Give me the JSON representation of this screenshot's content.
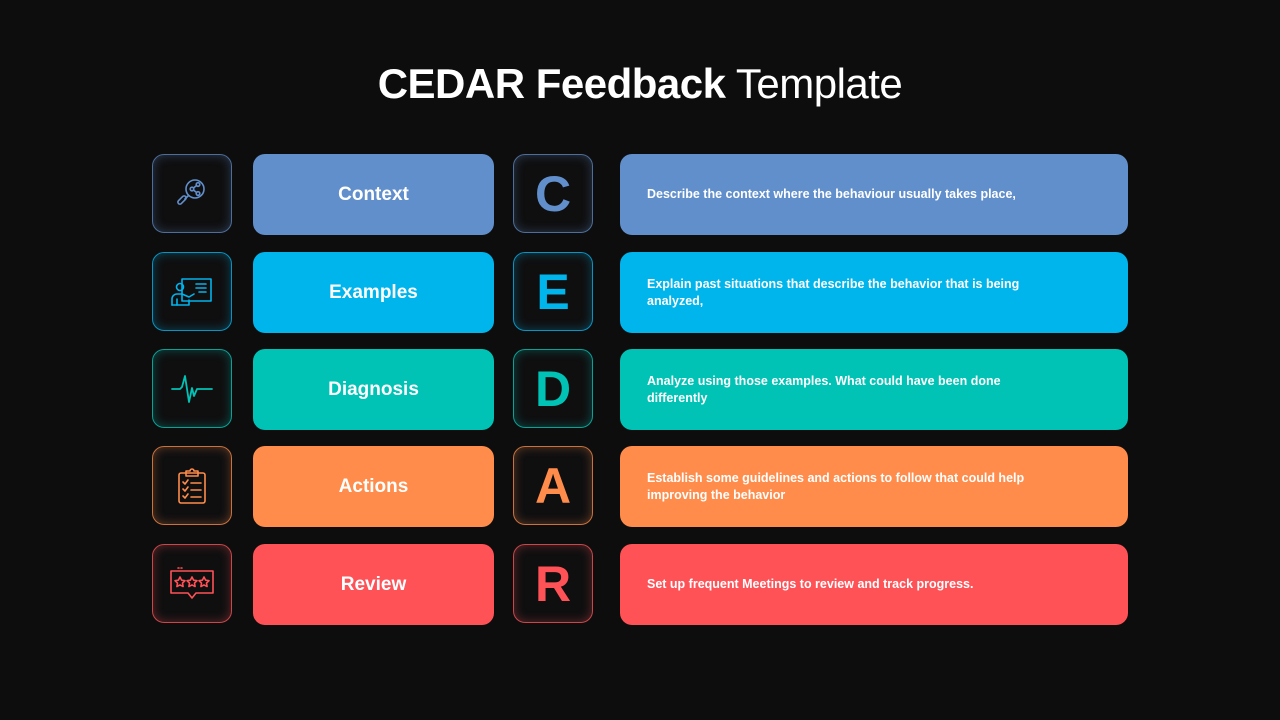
{
  "title": {
    "bold": "CEDAR Feedback",
    "light": "Template"
  },
  "rows": [
    {
      "letter": "C",
      "label": "Context",
      "description": "Describe the context where the behaviour usually takes place,",
      "icon": "magnifier-share-icon",
      "color": "#618fcb"
    },
    {
      "letter": "E",
      "label": "Examples",
      "description": "Explain past situations that describe the behavior that is being analyzed,",
      "icon": "presenter-board-icon",
      "color": "#00b4ec"
    },
    {
      "letter": "D",
      "label": "Diagnosis",
      "description": "Analyze using those examples. What could have been done differently",
      "icon": "heartbeat-icon",
      "color": "#00c2b5"
    },
    {
      "letter": "A",
      "label": "Actions",
      "description": "Establish some guidelines and actions to follow that could help improving the behavior",
      "icon": "clipboard-checklist-icon",
      "color": "#ff8c4a"
    },
    {
      "letter": "R",
      "label": "Review",
      "description": "Set up frequent Meetings to review and track progress.",
      "icon": "rating-stars-icon",
      "color": "#ff5257"
    }
  ]
}
